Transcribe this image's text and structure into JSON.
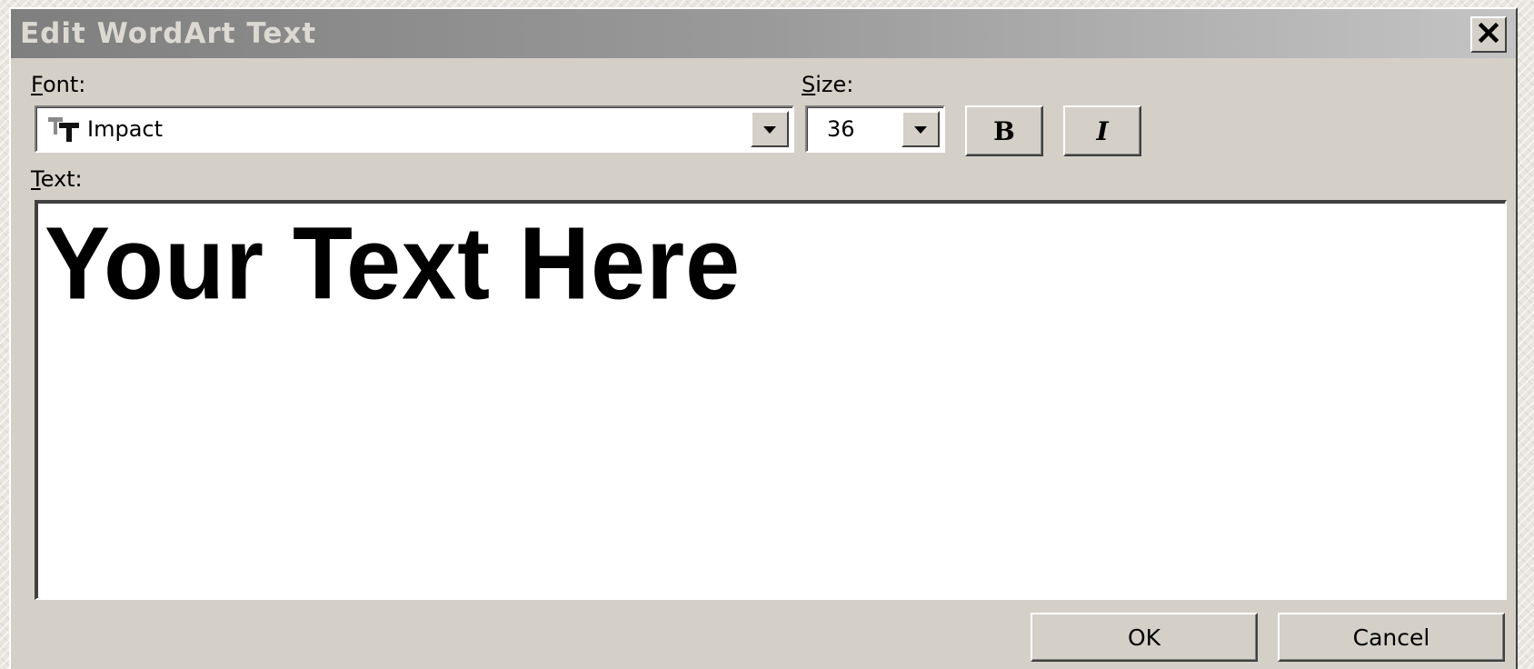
{
  "dialog": {
    "title": "Edit WordArt Text",
    "font_label_key": "F",
    "font_label_rest": "ont:",
    "font_value": "Impact",
    "size_label_key": "S",
    "size_label_rest": "ize:",
    "size_value": "36",
    "bold_label": "B",
    "italic_label": "I",
    "text_label_key": "T",
    "text_label_rest": "ext:",
    "text_value": "Your Text Here",
    "ok_label": "OK",
    "cancel_label": "Cancel",
    "icons": {
      "close": "close-icon",
      "font_type": "truetype-font-icon",
      "dropdown": "chevron-down-icon"
    },
    "colors": {
      "face": "#d4d0c8",
      "titlebar_start": "#7f7f7f",
      "titlebar_end": "#c4c4c4",
      "title_text": "#dcd9d2"
    }
  }
}
